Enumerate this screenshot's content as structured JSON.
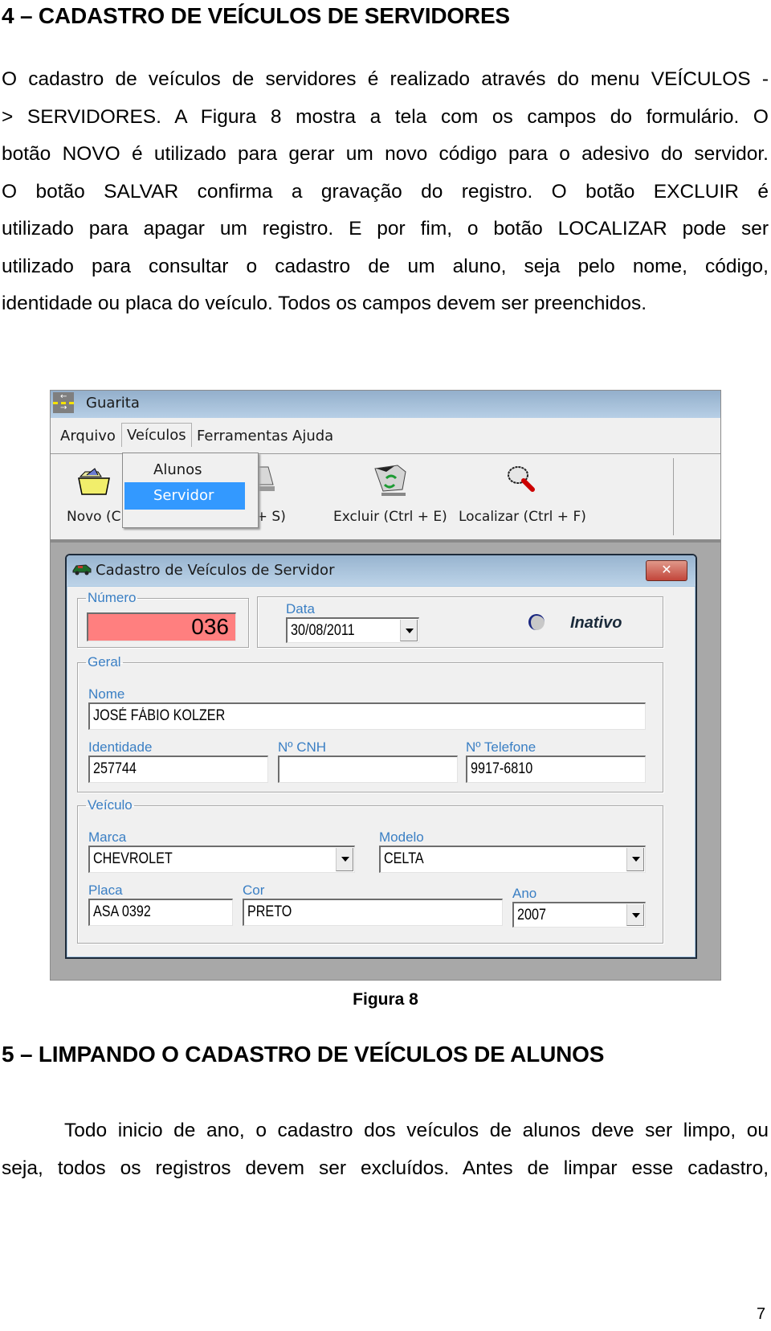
{
  "section4": {
    "heading": "4 – CADASTRO DE VEÍCULOS DE SERVIDORES",
    "paragraph_lines": [
      "O cadastro de veículos de servidores é realizado através do menu VEÍCULOS -",
      "> SERVIDORES. A Figura 8 mostra a tela com os campos do formulário. O",
      "botão NOVO é utilizado para gerar um novo código para o adesivo do servidor.",
      "O botão SALVAR confirma a gravação do registro. O botão EXCLUIR é",
      "utilizado para apagar um registro. E por fim, o botão LOCALIZAR pode ser",
      "utilizado para consultar o cadastro de um aluno, seja pelo nome, código,",
      "identidade ou placa do veículo. Todos os campos devem ser preenchidos."
    ]
  },
  "figure": {
    "app_title": "Guarita",
    "menu": [
      "Arquivo",
      "Veículos",
      "Ferramentas",
      "Ajuda"
    ],
    "dropdown_items": [
      "Alunos",
      "Servidor"
    ],
    "dropdown_selected": "Servidor",
    "toolbar": [
      {
        "label": "Novo (Ctrl + N)",
        "visible_label": "Novo (C",
        "icon": "folder-icon"
      },
      {
        "label": "Salvar (Ctrl + S)",
        "visible_label": "trl + S)",
        "icon": "save-icon"
      },
      {
        "label": "Excluir (Ctrl + E)",
        "visible_label": "Excluir (Ctrl + E)",
        "icon": "recycle-bin-icon"
      },
      {
        "label": "Localizar (Ctrl + F)",
        "visible_label": "Localizar (Ctrl + F)",
        "icon": "magnifier-icon"
      }
    ],
    "form": {
      "title": "Cadastro de Veículos de Servidor",
      "close_label": "✕",
      "numero_label": "Número",
      "numero_value": "036",
      "data_label": "Data",
      "data_value": "30/08/2011",
      "status_label": "Inativo",
      "geral_label": "Geral",
      "nome_label": "Nome",
      "nome_value": "JOSÉ FÁBIO KOLZER",
      "identidade_label": "Identidade",
      "identidade_value": "257744",
      "cnh_label": "Nº CNH",
      "cnh_value": "",
      "telefone_label": "Nº Telefone",
      "telefone_value": "9917-6810",
      "veiculo_label": "Veículo",
      "marca_label": "Marca",
      "marca_value": "CHEVROLET",
      "modelo_label": "Modelo",
      "modelo_value": "CELTA",
      "placa_label": "Placa",
      "placa_value": "ASA 0392",
      "cor_label": "Cor",
      "cor_value": "PRETO",
      "ano_label": "Ano",
      "ano_value": "2007"
    },
    "colors": {
      "numero_bg": "#ff7f7f",
      "selected_menu_bg": "#3399ff",
      "label_blue": "#3a7fc4"
    }
  },
  "caption": "Figura 8",
  "section5": {
    "heading": "5 – LIMPANDO O CADASTRO DE VEÍCULOS DE ALUNOS",
    "paragraph_lines": [
      "Todo inicio de ano, o cadastro dos veículos de alunos deve ser limpo, ou",
      "seja, todos os registros devem ser excluídos. Antes de limpar esse cadastro,"
    ]
  },
  "page_number": "7"
}
